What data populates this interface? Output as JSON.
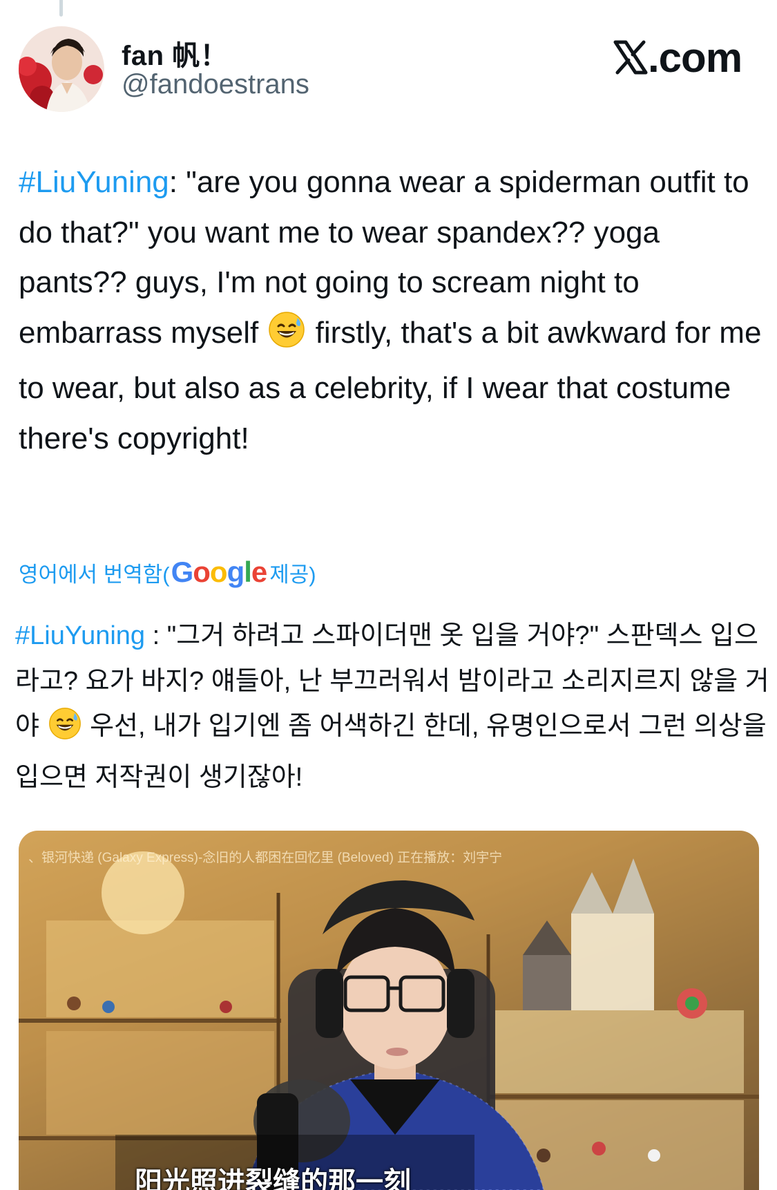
{
  "author": {
    "display_name": "fan 帆！",
    "handle": "@fandoestrans",
    "avatar": "avatar-photo"
  },
  "brand": {
    "label": ".com",
    "logo_icon": "x-logo-icon"
  },
  "tweet": {
    "hashtag": "#LiuYuning",
    "text_part1": ": \"are you gonna wear a spiderman outfit to do that?\" you want me to wear spandex?? yoga pants?? guys, I'm not going to scream night to embarrass myself",
    "emoji": "grinning-face-with-sweat-emoji",
    "text_part2": "firstly, that's a bit awkward for me to wear, but also as a celebrity, if I wear that costume there's copyright!"
  },
  "translation": {
    "label_prefix": "영어에서 번역함(",
    "google_letters": [
      "G",
      "o",
      "o",
      "g",
      "l",
      "e"
    ],
    "google_colors": [
      "#4285f4",
      "#ea4335",
      "#fbbc05",
      "#4285f4",
      "#34a853",
      "#ea4335"
    ],
    "label_suffix": "제공)",
    "hashtag": "#LiuYuning",
    "text_part1": " : \"그거 하려고 스파이더맨 옷 입을 거야?\" 스판덱스 입으라고? 요가 바지? 얘들아, 난 부끄러워서 밤이라고 소리지르지 않을 거야",
    "text_part2": "우선, 내가 입기엔 좀 어색하긴 한데, 유명인으로서 그런 의상을 입으면 저작권이 생기잖아!"
  },
  "media": {
    "top_text": "、银河快递 (Galaxy Express)-念旧的人都困在回忆里 (Beloved) 正在播放：刘宇宁",
    "subtitle": "阳光照进裂缝的那一刻"
  },
  "colors": {
    "link": "#1d9bf0",
    "text": "#0f1419",
    "secondary": "#536471"
  }
}
